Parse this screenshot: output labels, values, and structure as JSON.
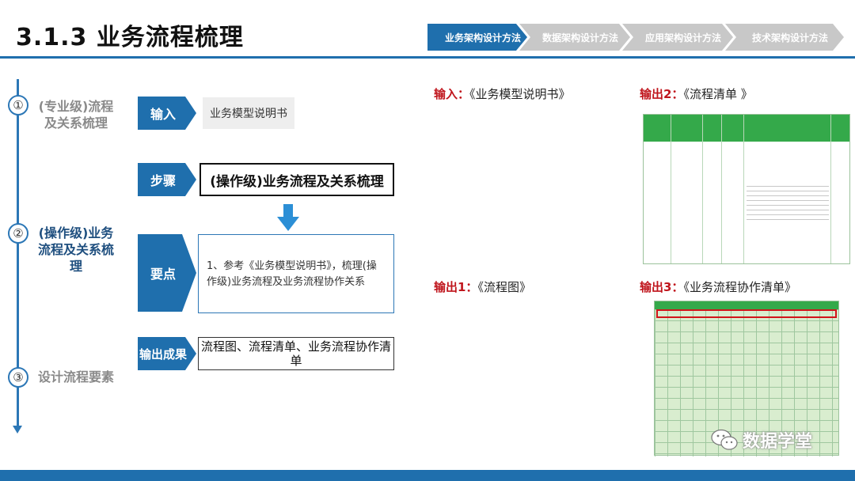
{
  "header": {
    "title": "3.1.3 业务流程梳理",
    "nav": [
      {
        "label": "业务架构设计方法",
        "active": true
      },
      {
        "label": "数据架构设计方法",
        "active": false
      },
      {
        "label": "应用架构设计方法",
        "active": false
      },
      {
        "label": "技术架构设计方法",
        "active": false
      }
    ]
  },
  "timeline": {
    "steps": [
      {
        "num": "①",
        "label": "(专业级)流程及关系梳理"
      },
      {
        "num": "②",
        "label": "(操作级)业务流程及关系梳理"
      },
      {
        "num": "③",
        "label": "设计流程要素"
      }
    ]
  },
  "process": {
    "input_tag": "输入",
    "input_value": "业务模型说明书",
    "step_tag": "步骤",
    "step_value": "(操作级)业务流程及关系梳理",
    "key_tag": "要点",
    "key_value": "1、参考《业务模型说明书》，梳理(操作级)业务流程及业务流程协作关系",
    "output_tag": "输出成果",
    "output_value": "流程图、流程清单、业务流程协作清单"
  },
  "right": {
    "in_prefix": "输入：",
    "in_text": "《业务模型说明书》",
    "out2_prefix": "输出2：",
    "out2_text": "《流程清单 》",
    "out1_prefix": "输出1：",
    "out1_text": "《流程图》",
    "out3_prefix": "输出3：",
    "out3_text": "《业务流程协作清单》"
  },
  "watermark": {
    "text": "数据学堂",
    "icon": "wechat-icon"
  },
  "colors": {
    "accent": "#1f6fad",
    "highlight_red": "#c0161d",
    "table_green": "#34a94a"
  }
}
